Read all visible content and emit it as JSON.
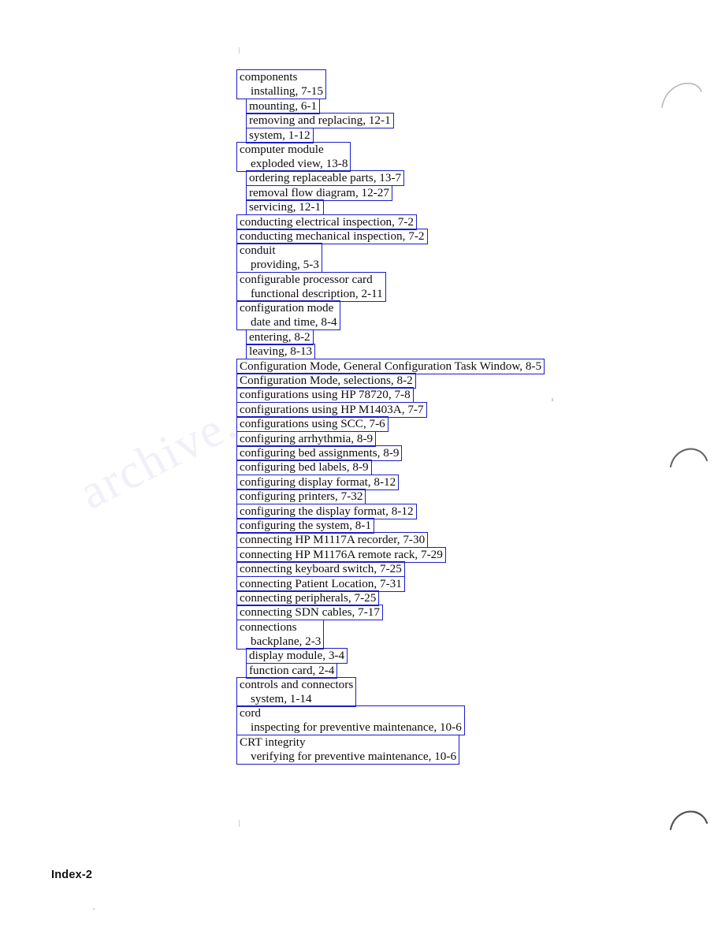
{
  "page": {
    "footer_label": "Index-2",
    "box_color": "#1c1ccc",
    "text_color": "#0d0d0d",
    "background": "#ffffff",
    "watermark_text": "archive."
  },
  "index": {
    "groups": [
      {
        "box_lines": [
          {
            "text": "components",
            "level": 0
          },
          {
            "text": "installing, 7-15",
            "level": 1
          }
        ],
        "indent": 0
      },
      {
        "box_lines": [
          {
            "text": "mounting, 6-1",
            "level": 1
          }
        ],
        "indent": 1
      },
      {
        "box_lines": [
          {
            "text": "removing and replacing, 12-1",
            "level": 1
          }
        ],
        "indent": 1
      },
      {
        "box_lines": [
          {
            "text": "system, 1-12",
            "level": 1
          }
        ],
        "indent": 1
      },
      {
        "box_lines": [
          {
            "text": "computer module",
            "level": 0
          },
          {
            "text": "exploded view, 13-8",
            "level": 1
          }
        ],
        "indent": 0
      },
      {
        "box_lines": [
          {
            "text": "ordering replaceable parts, 13-7",
            "level": 1
          }
        ],
        "indent": 1
      },
      {
        "box_lines": [
          {
            "text": "removal flow diagram, 12-27",
            "level": 1
          }
        ],
        "indent": 1
      },
      {
        "box_lines": [
          {
            "text": "servicing, 12-1",
            "level": 1
          }
        ],
        "indent": 1
      },
      {
        "box_lines": [
          {
            "text": "conducting electrical inspection, 7-2",
            "level": 0
          }
        ],
        "indent": 0
      },
      {
        "box_lines": [
          {
            "text": "conducting mechanical inspection, 7-2",
            "level": 0
          }
        ],
        "indent": 0
      },
      {
        "box_lines": [
          {
            "text": "conduit",
            "level": 0
          },
          {
            "text": "providing, 5-3",
            "level": 1
          }
        ],
        "indent": 0
      },
      {
        "box_lines": [
          {
            "text": "configurable processor card",
            "level": 0
          },
          {
            "text": "functional description, 2-11",
            "level": 1
          }
        ],
        "indent": 0
      },
      {
        "box_lines": [
          {
            "text": "configuration mode",
            "level": 0
          },
          {
            "text": "date and time, 8-4",
            "level": 1
          }
        ],
        "indent": 0
      },
      {
        "box_lines": [
          {
            "text": "entering, 8-2",
            "level": 1
          }
        ],
        "indent": 1
      },
      {
        "box_lines": [
          {
            "text": "leaving, 8-13",
            "level": 1
          }
        ],
        "indent": 1
      },
      {
        "box_lines": [
          {
            "text": "Configuration Mode, General Configuration Task Window, 8-5",
            "level": 0
          }
        ],
        "indent": 0
      },
      {
        "box_lines": [
          {
            "text": "Configuration Mode, selections, 8-2",
            "level": 0
          }
        ],
        "indent": 0
      },
      {
        "box_lines": [
          {
            "text": "configurations using HP 78720, 7-8",
            "level": 0
          }
        ],
        "indent": 0
      },
      {
        "box_lines": [
          {
            "text": "configurations using HP M1403A, 7-7",
            "level": 0
          }
        ],
        "indent": 0
      },
      {
        "box_lines": [
          {
            "text": "configurations using SCC, 7-6",
            "level": 0
          }
        ],
        "indent": 0
      },
      {
        "box_lines": [
          {
            "text": "configuring arrhythmia, 8-9",
            "level": 0
          }
        ],
        "indent": 0
      },
      {
        "box_lines": [
          {
            "text": "configuring bed assignments, 8-9",
            "level": 0
          }
        ],
        "indent": 0
      },
      {
        "box_lines": [
          {
            "text": "configuring bed labels, 8-9",
            "level": 0
          }
        ],
        "indent": 0
      },
      {
        "box_lines": [
          {
            "text": "configuring display format, 8-12",
            "level": 0
          }
        ],
        "indent": 0
      },
      {
        "box_lines": [
          {
            "text": "configuring printers, 7-32",
            "level": 0
          }
        ],
        "indent": 0
      },
      {
        "box_lines": [
          {
            "text": "configuring the display format, 8-12",
            "level": 0
          }
        ],
        "indent": 0
      },
      {
        "box_lines": [
          {
            "text": "configuring the system, 8-1",
            "level": 0
          }
        ],
        "indent": 0
      },
      {
        "box_lines": [
          {
            "text": "connecting HP M1117A recorder, 7-30",
            "level": 0
          }
        ],
        "indent": 0
      },
      {
        "box_lines": [
          {
            "text": "connecting HP M1176A remote rack, 7-29",
            "level": 0
          }
        ],
        "indent": 0
      },
      {
        "box_lines": [
          {
            "text": "connecting keyboard switch, 7-25",
            "level": 0
          }
        ],
        "indent": 0
      },
      {
        "box_lines": [
          {
            "text": "connecting Patient Location, 7-31",
            "level": 0
          }
        ],
        "indent": 0
      },
      {
        "box_lines": [
          {
            "text": "connecting peripherals, 7-25",
            "level": 0
          }
        ],
        "indent": 0
      },
      {
        "box_lines": [
          {
            "text": "connecting SDN cables, 7-17",
            "level": 0
          }
        ],
        "indent": 0
      },
      {
        "box_lines": [
          {
            "text": "connections",
            "level": 0
          },
          {
            "text": "backplane, 2-3",
            "level": 1
          }
        ],
        "indent": 0
      },
      {
        "box_lines": [
          {
            "text": "display module, 3-4",
            "level": 1
          }
        ],
        "indent": 1
      },
      {
        "box_lines": [
          {
            "text": "function card, 2-4",
            "level": 1
          }
        ],
        "indent": 1
      },
      {
        "box_lines": [
          {
            "text": "controls and connectors",
            "level": 0
          },
          {
            "text": "system, 1-14",
            "level": 1
          }
        ],
        "indent": 0
      },
      {
        "box_lines": [
          {
            "text": "cord",
            "level": 0
          },
          {
            "text": "inspecting for preventive maintenance, 10-6",
            "level": 1
          }
        ],
        "indent": 0
      },
      {
        "box_lines": [
          {
            "text": "CRT integrity",
            "level": 0
          },
          {
            "text": "verifying for preventive maintenance, 10-6",
            "level": 1
          }
        ],
        "indent": 0
      }
    ]
  }
}
